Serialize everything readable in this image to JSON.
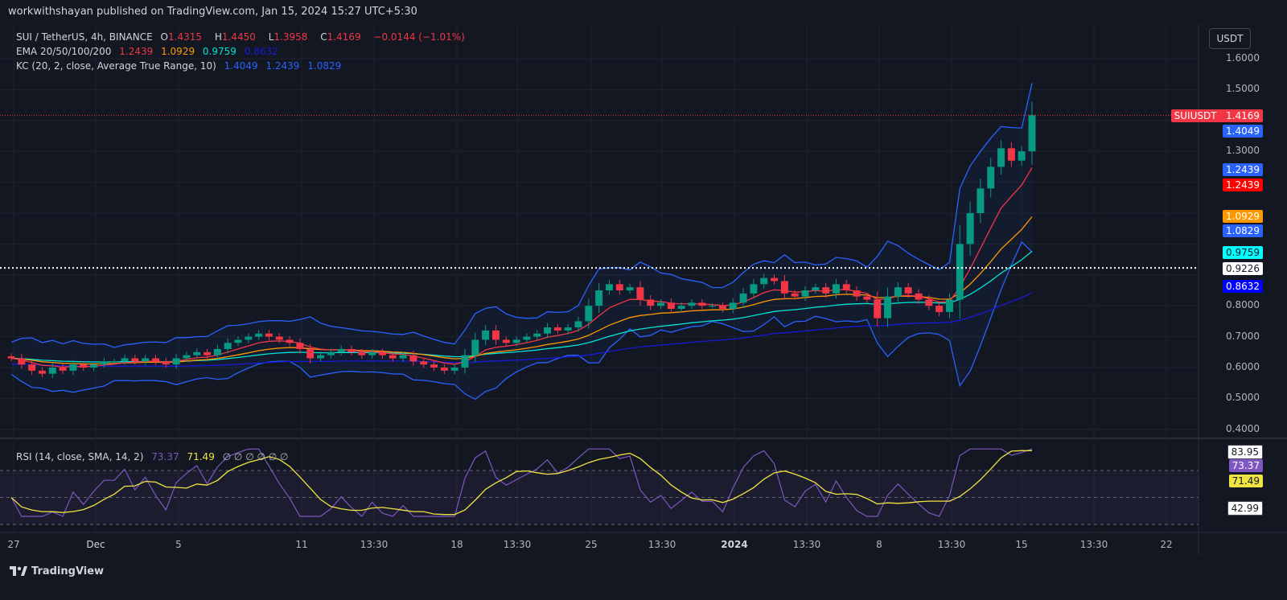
{
  "header": {
    "published": "workwithshayan published on TradingView.com, Jan 15, 2024 15:27 UTC+5:30"
  },
  "legend": {
    "symbol": "SUI / TetherUS, 4h, BINANCE",
    "o_label": "O",
    "o": "1.4315",
    "h_label": "H",
    "h": "1.4450",
    "l_label": "L",
    "l": "1.3958",
    "c_label": "C",
    "c": "1.4169",
    "change": "−0.0144 (−1.01%)",
    "ema_label": "EMA 20/50/100/200",
    "ema": [
      "1.2439",
      "1.0929",
      "0.9759",
      "0.8632"
    ],
    "kc_label": "KC (20, 2, close, Average True Range, 10)",
    "kc": [
      "1.4049",
      "1.2439",
      "1.0829"
    ],
    "rsi_label": "RSI (14, close, SMA, 14, 2)",
    "rsi": "73.37",
    "rsi_sma": "71.49",
    "rsi_empty": "∅ ∅ ∅ ∅ ∅ ∅"
  },
  "currency_button": "USDT",
  "footer": {
    "brand": "TradingView"
  },
  "colors": {
    "up": "#089981",
    "down": "#f23645",
    "ema20": "#f23645",
    "ema50": "#ff9800",
    "ema100": "#00e5d4",
    "ema200": "#1a1ad6",
    "kc": "#2962ff",
    "rsi": "#7e57c2",
    "rsi_sma": "#f0e442"
  },
  "chart_data": {
    "type": "candlestick",
    "title": "SUI / TetherUS, 4h, BINANCE",
    "ylim": [
      0.35,
      1.65
    ],
    "price_ticks": [
      "1.6000",
      "1.5000",
      "1.3000",
      "0.8000",
      "0.7000",
      "0.6000",
      "0.5000",
      "0.4000"
    ],
    "price_tags": [
      {
        "label": "SUIUSDT",
        "value": "1.4169",
        "color": "#f23645"
      },
      {
        "value": "1.4049",
        "color": "#2962ff"
      },
      {
        "value": "1.2439",
        "color": "#2962ff"
      },
      {
        "value": "1.2439",
        "color": "#ff0000"
      },
      {
        "value": "1.0929",
        "color": "#ff9800"
      },
      {
        "value": "1.0829",
        "color": "#2962ff"
      },
      {
        "value": "0.9759",
        "color": "#00ffff"
      },
      {
        "value": "0.9226",
        "color": "#ffffff"
      },
      {
        "value": "0.8632",
        "color": "#0000ff"
      }
    ],
    "horizontal_line": 0.9226,
    "x_ticks": [
      "27",
      "Dec",
      "5",
      "11",
      "13:30",
      "18",
      "13:30",
      "25",
      "13:30",
      "2024",
      "13:30",
      "8",
      "13:30",
      "15",
      "13:30",
      "22"
    ],
    "closes": [
      0.63,
      0.61,
      0.59,
      0.58,
      0.6,
      0.59,
      0.61,
      0.6,
      0.61,
      0.62,
      0.62,
      0.63,
      0.62,
      0.63,
      0.62,
      0.61,
      0.63,
      0.64,
      0.65,
      0.64,
      0.66,
      0.68,
      0.69,
      0.7,
      0.71,
      0.7,
      0.69,
      0.68,
      0.66,
      0.63,
      0.64,
      0.65,
      0.66,
      0.65,
      0.64,
      0.65,
      0.64,
      0.63,
      0.64,
      0.62,
      0.61,
      0.6,
      0.59,
      0.6,
      0.64,
      0.69,
      0.72,
      0.69,
      0.68,
      0.69,
      0.7,
      0.71,
      0.73,
      0.72,
      0.73,
      0.75,
      0.8,
      0.85,
      0.87,
      0.85,
      0.86,
      0.82,
      0.8,
      0.81,
      0.79,
      0.8,
      0.81,
      0.8,
      0.8,
      0.79,
      0.81,
      0.84,
      0.87,
      0.89,
      0.88,
      0.84,
      0.83,
      0.85,
      0.86,
      0.84,
      0.87,
      0.85,
      0.83,
      0.82,
      0.76,
      0.83,
      0.86,
      0.84,
      0.82,
      0.8,
      0.78,
      0.82,
      1.0,
      1.1,
      1.18,
      1.25,
      1.31,
      1.27,
      1.3,
      1.4169
    ],
    "rsi_ticks": [
      "83.95",
      "73.37",
      "71.49",
      "42.99"
    ],
    "rsi_levels": [
      70,
      50,
      30
    ]
  }
}
